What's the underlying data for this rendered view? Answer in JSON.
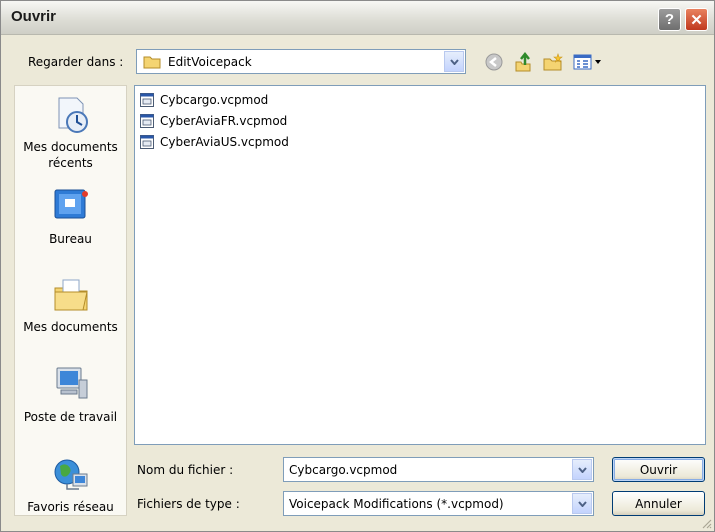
{
  "window": {
    "title": "Ouvrir",
    "help_label": "?",
    "close_label": "✕"
  },
  "lookin": {
    "label": "Regarder dans :",
    "value": "EditVoicepack"
  },
  "toolbar": {
    "icons": [
      "back-icon",
      "up-folder-icon",
      "new-folder-icon",
      "view-menu-icon"
    ]
  },
  "places": [
    {
      "label": "Mes documents récents",
      "icon": "recent-documents-icon"
    },
    {
      "label": "Bureau",
      "icon": "desktop-icon"
    },
    {
      "label": "Mes documents",
      "icon": "my-documents-icon"
    },
    {
      "label": "Poste de travail",
      "icon": "my-computer-icon"
    },
    {
      "label": "Favoris réseau",
      "icon": "network-places-icon"
    }
  ],
  "files": [
    {
      "name": "Cybcargo.vcpmod"
    },
    {
      "name": "CyberAviaFR.vcpmod"
    },
    {
      "name": "CyberAviaUS.vcpmod"
    }
  ],
  "filename": {
    "label": "Nom du fichier :",
    "value": "Cybcargo.vcpmod"
  },
  "filetype": {
    "label": "Fichiers de type :",
    "value": "Voicepack Modifications (*.vcpmod)"
  },
  "buttons": {
    "open": "Ouvrir",
    "cancel": "Annuler"
  },
  "colors": {
    "close_red": "#c0391e",
    "field_border": "#7f9db9",
    "dialog_bg": "#ece9d8"
  }
}
